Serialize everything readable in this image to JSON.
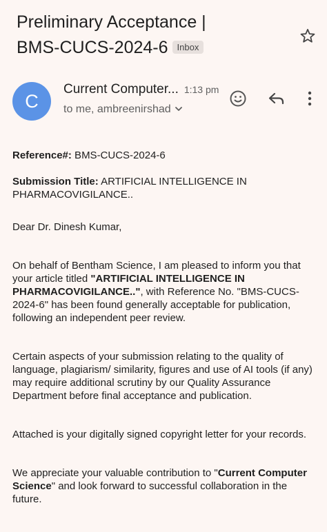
{
  "email": {
    "subject_line1": "Preliminary Acceptance |",
    "subject_line2": "BMS-CUCS-2024-6",
    "label": "Inbox",
    "sender_initial": "C",
    "sender_name": "Current Computer...",
    "time": "1:13 pm",
    "recipients": "to me, ambreenirshad"
  },
  "icons": {
    "star": "star-icon",
    "emoji": "smiley-icon",
    "reply": "reply-icon",
    "more": "more-vert-icon",
    "expand": "chevron-down-icon"
  },
  "body": {
    "reference_label": "Reference#:",
    "reference_value": " BMS-CUCS-2024-6",
    "title_label": "Submission Title:",
    "title_value": " ARTIFICIAL INTELLIGENCE IN PHARMACOVIGILANCE..",
    "greeting": "Dear Dr. Dinesh Kumar,",
    "p1_a": "On behalf of Bentham Science, I am pleased to inform you that your article titled ",
    "p1_b": "\"ARTIFICIAL INTELLIGENCE IN PHARMACOVIGILANCE..\"",
    "p1_c": ", with Reference No. \"BMS-CUCS-2024-6\" has been found generally acceptable for publication, following an independent peer review.",
    "p2": "Certain aspects of your submission relating to the quality of language, plagiarism/ similarity, figures and use of AI tools (if any) may require additional scrutiny by our Quality Assurance Department before final acceptance and publication.",
    "p3": "Attached is your digitally signed copyright letter for your records.",
    "p4_a": "We appreciate your valuable contribution to \"",
    "p4_b": "Current Computer Science",
    "p4_c": "\" and look forward to successful collaboration in the future."
  },
  "colors": {
    "background": "#fdf6f3",
    "avatar": "#5b93e6",
    "chip": "#e7e0dd"
  }
}
